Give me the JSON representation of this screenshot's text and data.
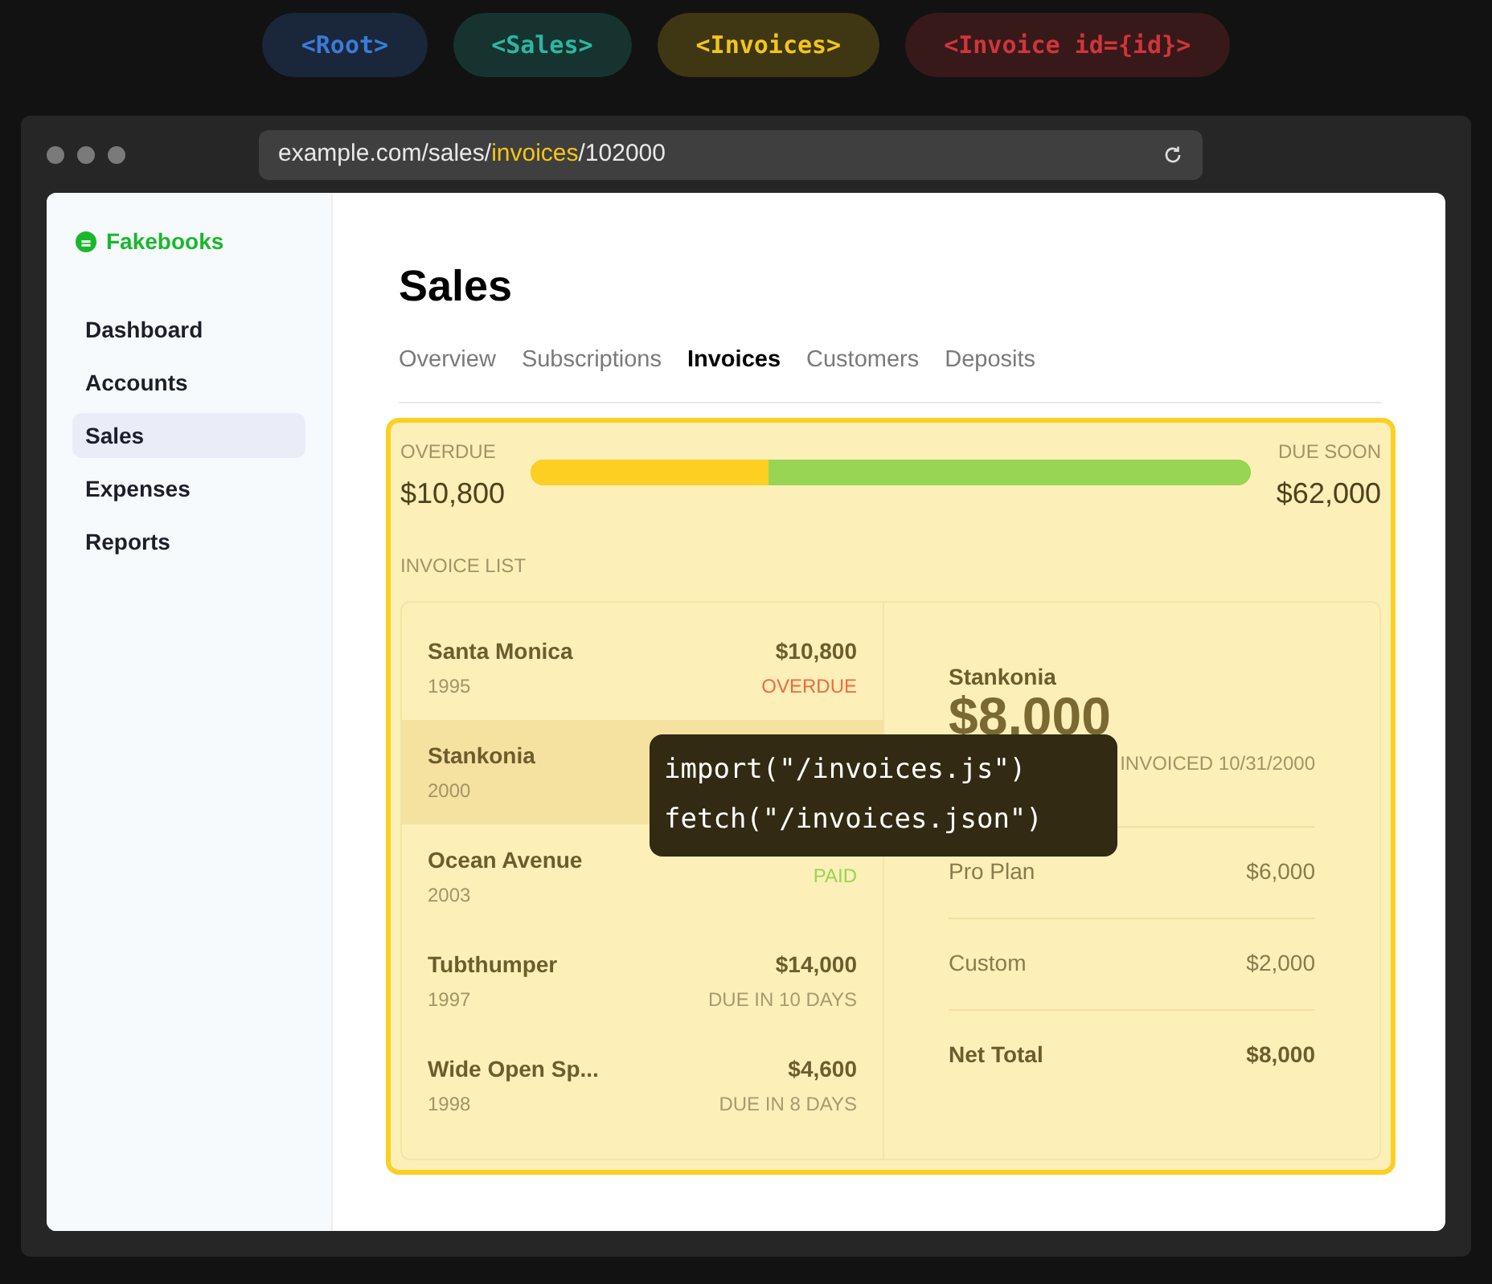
{
  "route_pills": [
    {
      "label": "<Root>",
      "color": "#1a273a"
    },
    {
      "label": "<Sales>",
      "color": "#17332f"
    },
    {
      "label": "<Invoices>",
      "color": "#3f3613"
    },
    {
      "label": "<Invoice id={id}>",
      "color": "#38191a"
    }
  ],
  "browser": {
    "url": [
      {
        "text": "example.com/sales/",
        "highlight": false
      },
      {
        "text": "invoices",
        "highlight": true
      },
      {
        "text": "/102000",
        "highlight": false
      }
    ]
  },
  "sidebar": {
    "brand": "Fakebooks",
    "items": [
      {
        "label": "Dashboard",
        "selected": false
      },
      {
        "label": "Accounts",
        "selected": false
      },
      {
        "label": "Sales",
        "selected": true
      },
      {
        "label": "Expenses",
        "selected": false
      },
      {
        "label": "Reports",
        "selected": false
      }
    ]
  },
  "page": {
    "title": "Sales",
    "tabs": [
      {
        "label": "Overview",
        "selected": false
      },
      {
        "label": "Subscriptions",
        "selected": false
      },
      {
        "label": "Invoices",
        "selected": true
      },
      {
        "label": "Customers",
        "selected": false
      },
      {
        "label": "Deposits",
        "selected": false
      }
    ]
  },
  "summary": {
    "overdue_label": "OVERDUE",
    "overdue_value": "$10,800",
    "due_soon_label": "DUE SOON",
    "due_soon_value": "$62,000",
    "level": 0.33
  },
  "invoice_list": {
    "label": "INVOICE LIST",
    "items": [
      {
        "name": "Santa Monica",
        "year": "1995",
        "amount": "$10,800",
        "status": "OVERDUE",
        "kind": "overdue",
        "selected": false
      },
      {
        "name": "Stankonia",
        "year": "2000",
        "selected": true
      },
      {
        "name": "Ocean Avenue",
        "year": "2003",
        "status": "PAID",
        "kind": "paid",
        "selected": false
      },
      {
        "name": "Tubthumper",
        "year": "1997",
        "amount": "$14,000",
        "status": "DUE IN 10 DAYS",
        "kind": "due",
        "selected": false
      },
      {
        "name": "Wide Open Sp...",
        "year": "1998",
        "amount": "$4,600",
        "status": "DUE IN 8 DAYS",
        "kind": "due",
        "selected": false
      }
    ]
  },
  "invoice_detail": {
    "name": "Stankonia",
    "amount": "$8,000",
    "meta": "INVOICED 10/31/2000",
    "lines": [
      {
        "label": "Pro Plan",
        "amount": "$6,000",
        "kind": "item"
      },
      {
        "label": "Custom",
        "amount": "$2,000",
        "kind": "item"
      },
      {
        "label": "Net Total",
        "amount": "$8,000",
        "kind": "total"
      }
    ]
  },
  "overlay": {
    "lines": [
      "import(\"/invoices.js\")",
      "fetch(\"/invoices.json\")"
    ]
  }
}
